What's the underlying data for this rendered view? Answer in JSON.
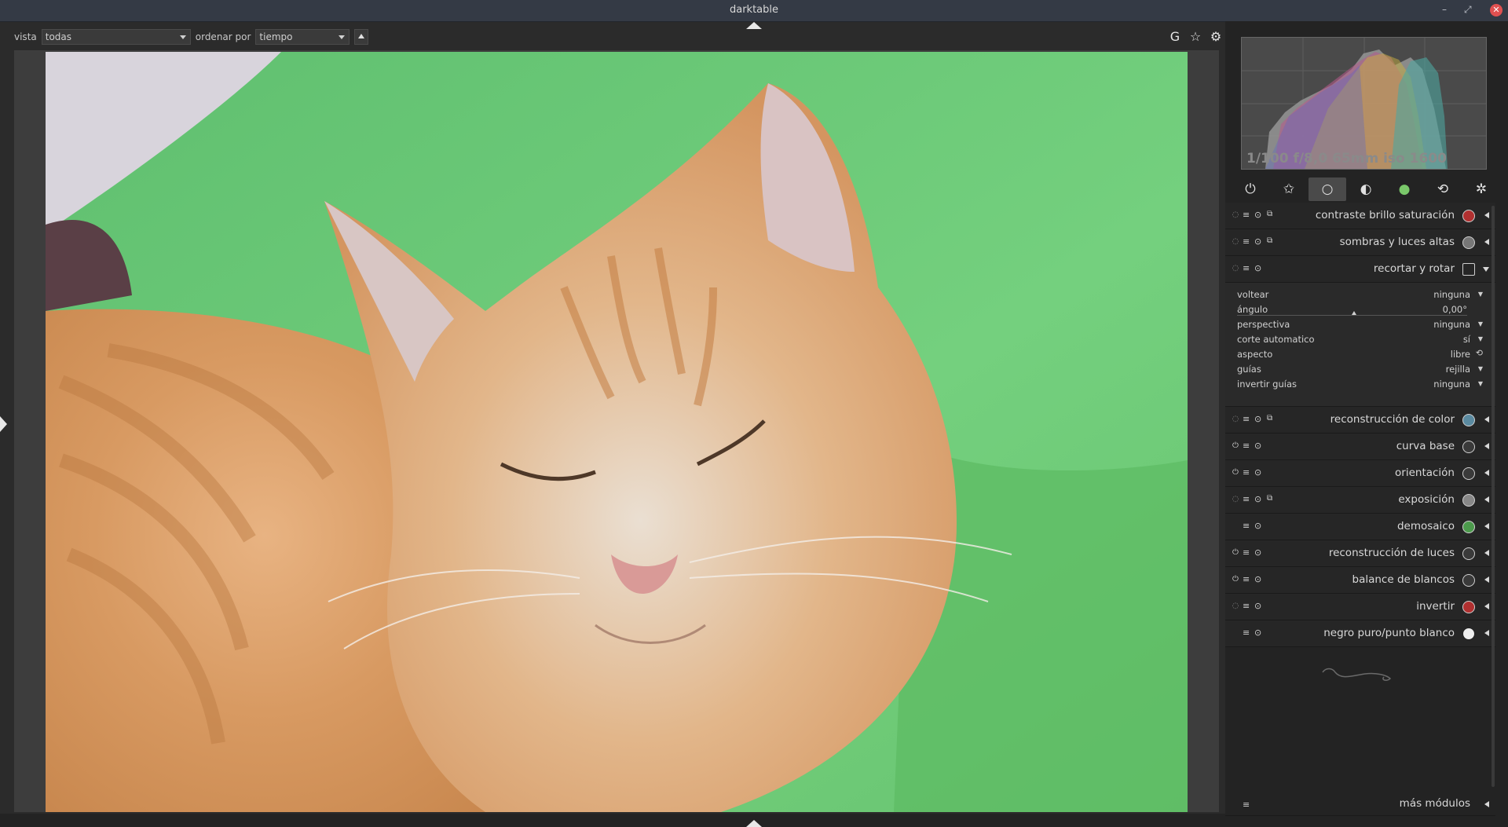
{
  "window": {
    "title": "darktable",
    "minimize": "–",
    "maximize": "⤢",
    "close": "✕"
  },
  "filter": {
    "view_label": "vista",
    "view_value": "todas",
    "sort_label": "ordenar por",
    "sort_value": "tiempo"
  },
  "top_icons": [
    {
      "icon": "grouping-icon",
      "glyph": "G"
    },
    {
      "icon": "star-icon",
      "glyph": "☆"
    },
    {
      "icon": "gear-icon",
      "glyph": "⚙"
    }
  ],
  "histogram": {
    "exif": "1/100 f/8,0 65mm iso 1600"
  },
  "module_groups": [
    {
      "icon": "power-icon",
      "glyph": "⏻"
    },
    {
      "icon": "favorites-icon",
      "glyph": "✩"
    },
    {
      "icon": "basic-group-icon",
      "glyph": "○",
      "active": true
    },
    {
      "icon": "tone-group-icon",
      "glyph": "◐"
    },
    {
      "icon": "color-group-icon",
      "glyph": "●"
    },
    {
      "icon": "correct-group-icon",
      "glyph": "⟲"
    },
    {
      "icon": "effect-group-icon",
      "glyph": "✲"
    }
  ],
  "modules": [
    {
      "name": "contraste brillo saturación",
      "on": false,
      "copy": true
    },
    {
      "name": "sombras y luces altas",
      "on": false,
      "copy": true
    },
    {
      "name": "recortar y rotar",
      "on": false,
      "copy": false,
      "expanded": true
    }
  ],
  "crop_params": [
    {
      "label": "voltear",
      "value": "ninguna",
      "arrow": "▼"
    },
    {
      "label": "ángulo",
      "value": "0,00°",
      "arrow": "",
      "slider": true
    },
    {
      "label": "perspectiva",
      "value": "ninguna",
      "arrow": "▼"
    },
    {
      "label": "corte automatico",
      "value": "sí",
      "arrow": "▼"
    },
    {
      "label": "aspecto",
      "value": "libre",
      "arrow": "⟲"
    },
    {
      "label": "guías",
      "value": "rejilla",
      "arrow": "▼"
    },
    {
      "label": "invertir guías",
      "value": "ninguna",
      "arrow": "▼"
    }
  ],
  "modules_after": [
    {
      "name": "reconstrucción de color",
      "on": false,
      "copy": true
    },
    {
      "name": "curva base",
      "on": true,
      "copy": false
    },
    {
      "name": "orientación",
      "on": true,
      "copy": false
    },
    {
      "name": "exposición",
      "on": false,
      "copy": true
    },
    {
      "name": "demosaico",
      "on": null,
      "copy": false
    },
    {
      "name": "reconstrucción de luces",
      "on": true,
      "copy": false
    },
    {
      "name": "balance de blancos",
      "on": true,
      "copy": false
    },
    {
      "name": "invertir",
      "on": false,
      "copy": false
    },
    {
      "name": "negro puro/punto blanco",
      "on": null,
      "copy": false
    }
  ],
  "more_modules": "más módulos",
  "colors": {
    "accent": "#4a4a4a",
    "close": "#e05050",
    "panel": "#232323"
  }
}
